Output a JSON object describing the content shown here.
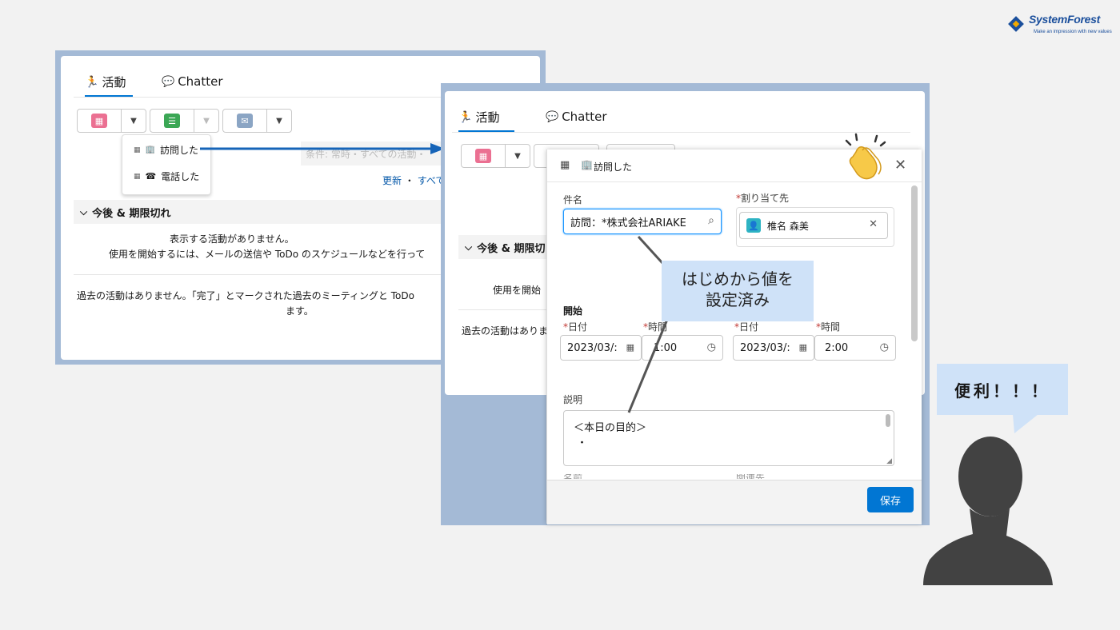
{
  "brand": {
    "name": "SystemForest",
    "tagline": "Make an impression with new values"
  },
  "left_panel": {
    "tabs": [
      {
        "label": "活動"
      },
      {
        "label": "Chatter"
      }
    ],
    "dropdown_items": [
      "訪問した",
      "電話した"
    ],
    "filter_text": "条件: 常時・すべての活動・",
    "links": {
      "refresh": "更新",
      "sep": "・",
      "all": "すべて"
    },
    "section_title": "今後 & 期限切れ",
    "empty_line1": "表示する活動がありません。",
    "empty_line2": "使用を開始するには、メールの送信や ToDo のスケジュールなどを行って",
    "past_line1": "過去の活動はありません。「完了」とマークされた過去のミーティングと ToDo",
    "past_line2": "ます。"
  },
  "right_panel": {
    "tabs": [
      {
        "label": "活動"
      },
      {
        "label": "Chatter"
      }
    ],
    "section_title": "今後 & 期限切",
    "empty_text": "使用を開始",
    "past_text": "過去の活動はありま"
  },
  "modal": {
    "title": "訪問した",
    "subject_label": "件名",
    "subject_value": "訪問：*株式会社ARIAKE",
    "assign_label": "割り当て先",
    "assign_value": "椎名 森美",
    "start_label": "開始",
    "date_label": "日付",
    "time_label": "時間",
    "start_date": "2023/03/:",
    "start_time": "1:00",
    "end_date": "2023/03/:",
    "end_time": "2:00",
    "desc_label": "説明",
    "desc_line1": "＜本日の目的＞",
    "desc_line2": "・",
    "save_label": "保存",
    "cut_label1": "名前",
    "cut_label2": "関連先"
  },
  "callout_text": {
    "line1": "はじめから値を",
    "line2": "設定済み"
  },
  "speech_bubble": "便利！！！",
  "colors": {
    "accent": "#0176d3",
    "event": "#eb7092",
    "task": "#3ba755",
    "email": "#8ba5c4",
    "callout": "#cfe2f8",
    "frame": "#a4bad6"
  },
  "icons": [
    "calendar-icon",
    "task-icon",
    "email-icon",
    "search-icon",
    "clock-icon",
    "close-icon",
    "user-icon",
    "clapping-hands-icon",
    "person-silhouette-icon"
  ]
}
